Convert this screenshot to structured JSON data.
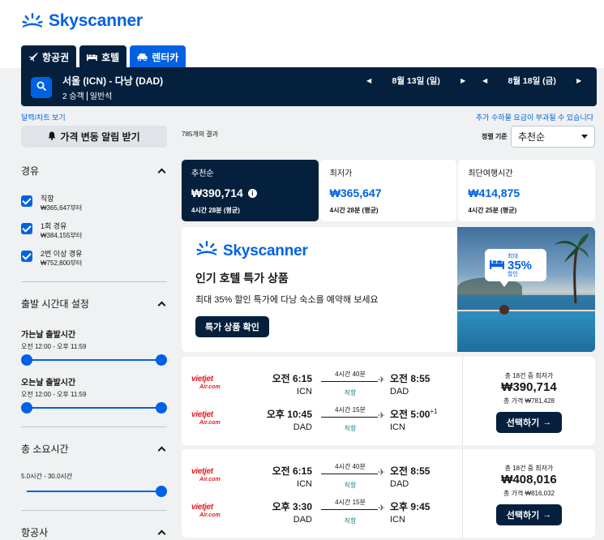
{
  "brand": {
    "name": "Skyscanner",
    "color": "#0062e3",
    "dark": "#05203c"
  },
  "tabs": [
    {
      "label": "항공권",
      "icon": "plane-icon",
      "active": false
    },
    {
      "label": "호텔",
      "icon": "bed-icon",
      "active": false
    },
    {
      "label": "렌터카",
      "icon": "car-icon",
      "active": true
    }
  ],
  "search": {
    "route": "서울 (ICN) - 다낭 (DAD)",
    "travelers": "2 승객",
    "cabin": "일반석",
    "depart_date": "8월 13일 (일)",
    "return_date": "8월 18일 (금)"
  },
  "links": {
    "calendar": "달력/차트 보기",
    "fees": "추가 수하물 요금이 부과될 수 있습니다"
  },
  "sidebar": {
    "alert_button": "가격 변동 알림 받기",
    "stops": {
      "title": "경유",
      "options": [
        {
          "label": "직항",
          "price": "₩365,647부터",
          "checked": true
        },
        {
          "label": "1회 경유",
          "price": "₩384,155부터",
          "checked": true
        },
        {
          "label": "2번 이상 경유",
          "price": "₩752,800부터",
          "checked": true
        }
      ]
    },
    "times": {
      "title": "출발 시간대 설정",
      "outbound_title": "가는날 출발시간",
      "outbound_range": "오전 12:00 - 오후 11:59",
      "return_title": "오는날 출발시간",
      "return_range": "오전 12:00 - 오후 11:59"
    },
    "duration": {
      "title": "총 소요시간",
      "range": "5.0시간 - 30.0시간"
    },
    "airlines": {
      "title": "항공사"
    }
  },
  "results": {
    "count": "785개의 결과",
    "sort_label": "정렬 기준",
    "sort_value": "추천순"
  },
  "sort_tabs": [
    {
      "label": "추천순",
      "price": "₩390,714",
      "duration": "4시간 28분 (평균)",
      "active": true
    },
    {
      "label": "최저가",
      "price": "₩365,647",
      "duration": "4시간 28분 (평균)",
      "active": false
    },
    {
      "label": "최단여행시간",
      "price": "₩414,875",
      "duration": "4시간 25분 (평균)",
      "active": false
    }
  ],
  "ad": {
    "title": "인기 호텔 특가 상품",
    "description": "최대 35% 할인 특가에 다낭 숙소를 예약해 보세요",
    "button": "특가 상품 확인",
    "badge_top": "최대",
    "badge_value": "35%",
    "badge_bottom": "할인"
  },
  "flights": [
    {
      "legs": [
        {
          "airline_line1": "vietjet",
          "airline_line2": "Air.com",
          "dep_time": "오전 6:15",
          "dep_code": "ICN",
          "duration": "4시간 40분",
          "stops": "직항",
          "arr_time": "오전 8:55",
          "arr_code": "DAD",
          "day_offset": ""
        },
        {
          "airline_line1": "vietjet",
          "airline_line2": "Air.com",
          "dep_time": "오후 10:45",
          "dep_code": "DAD",
          "duration": "4시간 15분",
          "stops": "직항",
          "arr_time": "오전 5:00",
          "arr_code": "ICN",
          "day_offset": "+1"
        }
      ],
      "deals": "총 18건 중 최저가",
      "price": "₩390,714",
      "total": "총 가격 ₩781,428",
      "button": "선택하기"
    },
    {
      "legs": [
        {
          "airline_line1": "vietjet",
          "airline_line2": "Air.com",
          "dep_time": "오전 6:15",
          "dep_code": "ICN",
          "duration": "4시간 40분",
          "stops": "직항",
          "arr_time": "오전 8:55",
          "arr_code": "DAD",
          "day_offset": ""
        },
        {
          "airline_line1": "vietjet",
          "airline_line2": "Air.com",
          "dep_time": "오후 3:30",
          "dep_code": "DAD",
          "duration": "4시간 15분",
          "stops": "직항",
          "arr_time": "오후 9:45",
          "arr_code": "ICN",
          "day_offset": ""
        }
      ],
      "deals": "총 18건 중 최저가",
      "price": "₩408,016",
      "total": "총 가격 ₩816,032",
      "button": "선택하기"
    }
  ]
}
